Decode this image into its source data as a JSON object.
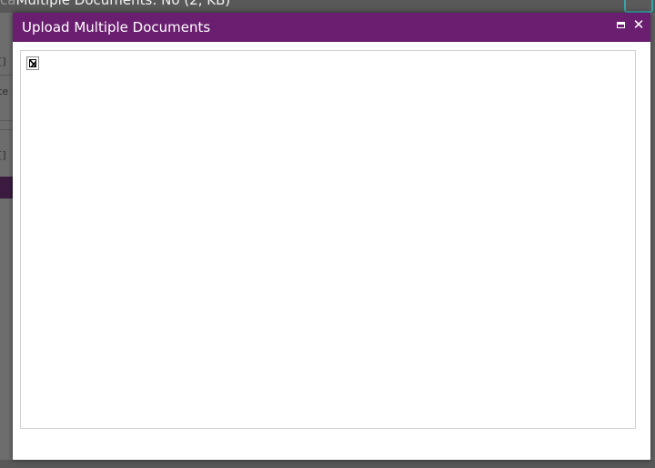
{
  "background": {
    "page_title_prefix": "ca",
    "page_title": "Multiple Documents: No (2, KB)",
    "left_fragments": [
      "[]",
      "te",
      "[]"
    ]
  },
  "dialog": {
    "title": "Upload Multiple Documents",
    "maximize_icon": "maximize-icon",
    "close_glyph": "✕",
    "content_icon": "broken-frame-icon"
  },
  "colors": {
    "titlebar": "#6a1e70",
    "overlay": "#6b6b6b",
    "accent_teal": "#3aa3a8"
  }
}
